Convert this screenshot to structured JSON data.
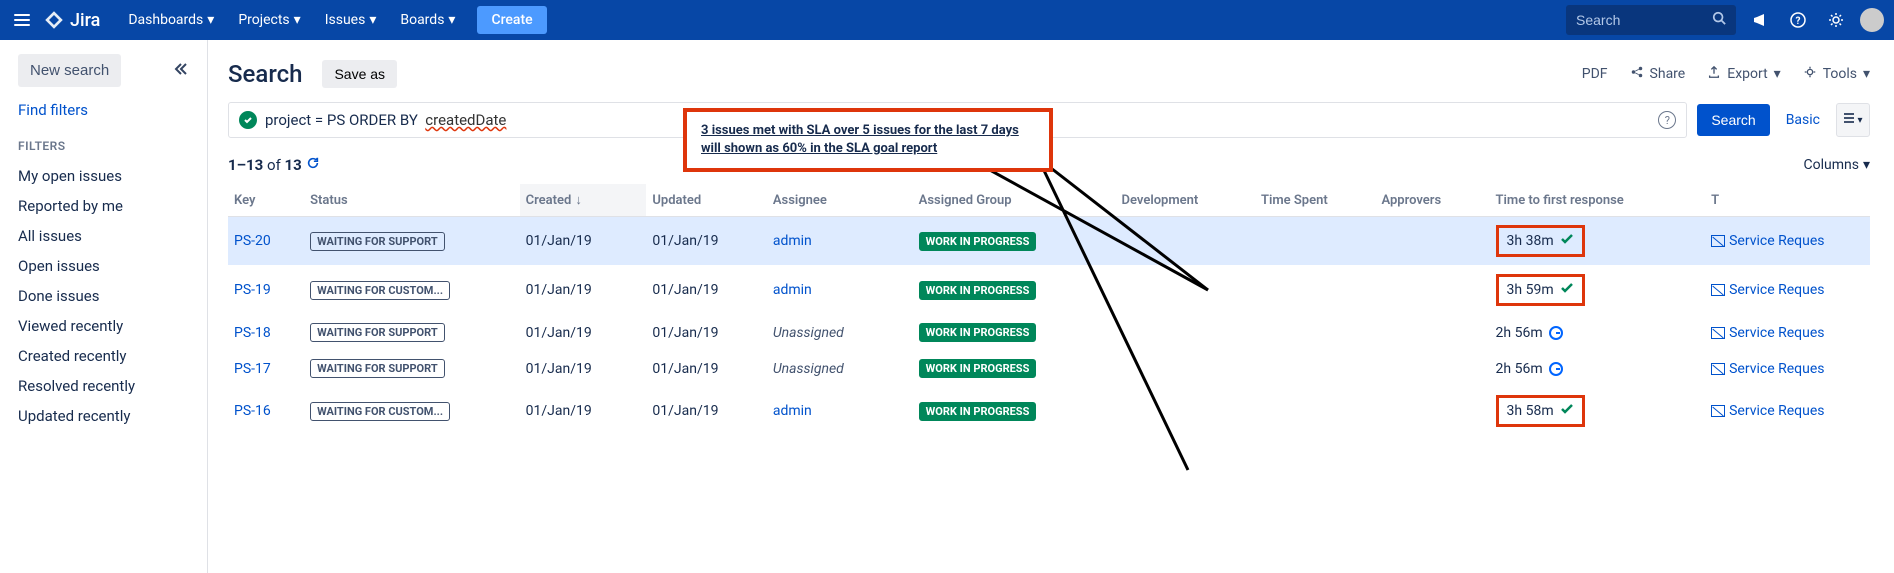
{
  "topnav": {
    "logo_text": "Jira",
    "items": [
      "Dashboards",
      "Projects",
      "Issues",
      "Boards"
    ],
    "create": "Create",
    "search_placeholder": "Search"
  },
  "sidebar": {
    "new_search": "New search",
    "find_filters": "Find filters",
    "filters_label": "FILTERS",
    "filters": [
      "My open issues",
      "Reported by me",
      "All issues",
      "Open issues",
      "Done issues",
      "Viewed recently",
      "Created recently",
      "Resolved recently",
      "Updated recently"
    ]
  },
  "header": {
    "title": "Search",
    "save_as": "Save as",
    "actions": {
      "pdf": "PDF",
      "share": "Share",
      "export": "Export",
      "tools": "Tools"
    }
  },
  "jql": {
    "prefix": "project = PS ORDER BY",
    "orderfield": "createdDate",
    "search_btn": "Search",
    "basic": "Basic"
  },
  "results": {
    "range": "1–13",
    "of": "of",
    "total": "13",
    "columns_label": "Columns"
  },
  "columns": [
    "Key",
    "Status",
    "Created",
    "Updated",
    "Assignee",
    "Assigned Group",
    "Development",
    "Time Spent",
    "Approvers",
    "Time to first response",
    "T"
  ],
  "callout": {
    "line1": "3 issues met with SLA over  5 issues for the last 7 days",
    "line2": "will shown as 60% in the SLA goal report"
  },
  "rows": [
    {
      "key": "PS-20",
      "status": "WAITING FOR SUPPORT",
      "created": "01/Jan/19",
      "updated": "01/Jan/19",
      "assignee": "admin",
      "assignee_link": true,
      "group": "WORK IN PROGRESS",
      "sla": "3h 38m",
      "sla_state": "met",
      "sla_boxed": true,
      "t": "Service Reques",
      "highlight": true
    },
    {
      "key": "PS-19",
      "status": "WAITING FOR CUSTOM...",
      "created": "01/Jan/19",
      "updated": "01/Jan/19",
      "assignee": "admin",
      "assignee_link": true,
      "group": "WORK IN PROGRESS",
      "sla": "3h 59m",
      "sla_state": "met",
      "sla_boxed": true,
      "t": "Service Reques"
    },
    {
      "key": "PS-18",
      "status": "WAITING FOR SUPPORT",
      "created": "01/Jan/19",
      "updated": "01/Jan/19",
      "assignee": "Unassigned",
      "assignee_link": false,
      "group": "WORK IN PROGRESS",
      "sla": "2h 56m",
      "sla_state": "ongoing",
      "sla_boxed": false,
      "t": "Service Reques"
    },
    {
      "key": "PS-17",
      "status": "WAITING FOR SUPPORT",
      "created": "01/Jan/19",
      "updated": "01/Jan/19",
      "assignee": "Unassigned",
      "assignee_link": false,
      "group": "WORK IN PROGRESS",
      "sla": "2h 56m",
      "sla_state": "ongoing",
      "sla_boxed": false,
      "t": "Service Reques"
    },
    {
      "key": "PS-16",
      "status": "WAITING FOR CUSTOM...",
      "created": "01/Jan/19",
      "updated": "01/Jan/19",
      "assignee": "admin",
      "assignee_link": true,
      "group": "WORK IN PROGRESS",
      "sla": "3h 58m",
      "sla_state": "met",
      "sla_boxed": true,
      "t": "Service Reques"
    }
  ]
}
